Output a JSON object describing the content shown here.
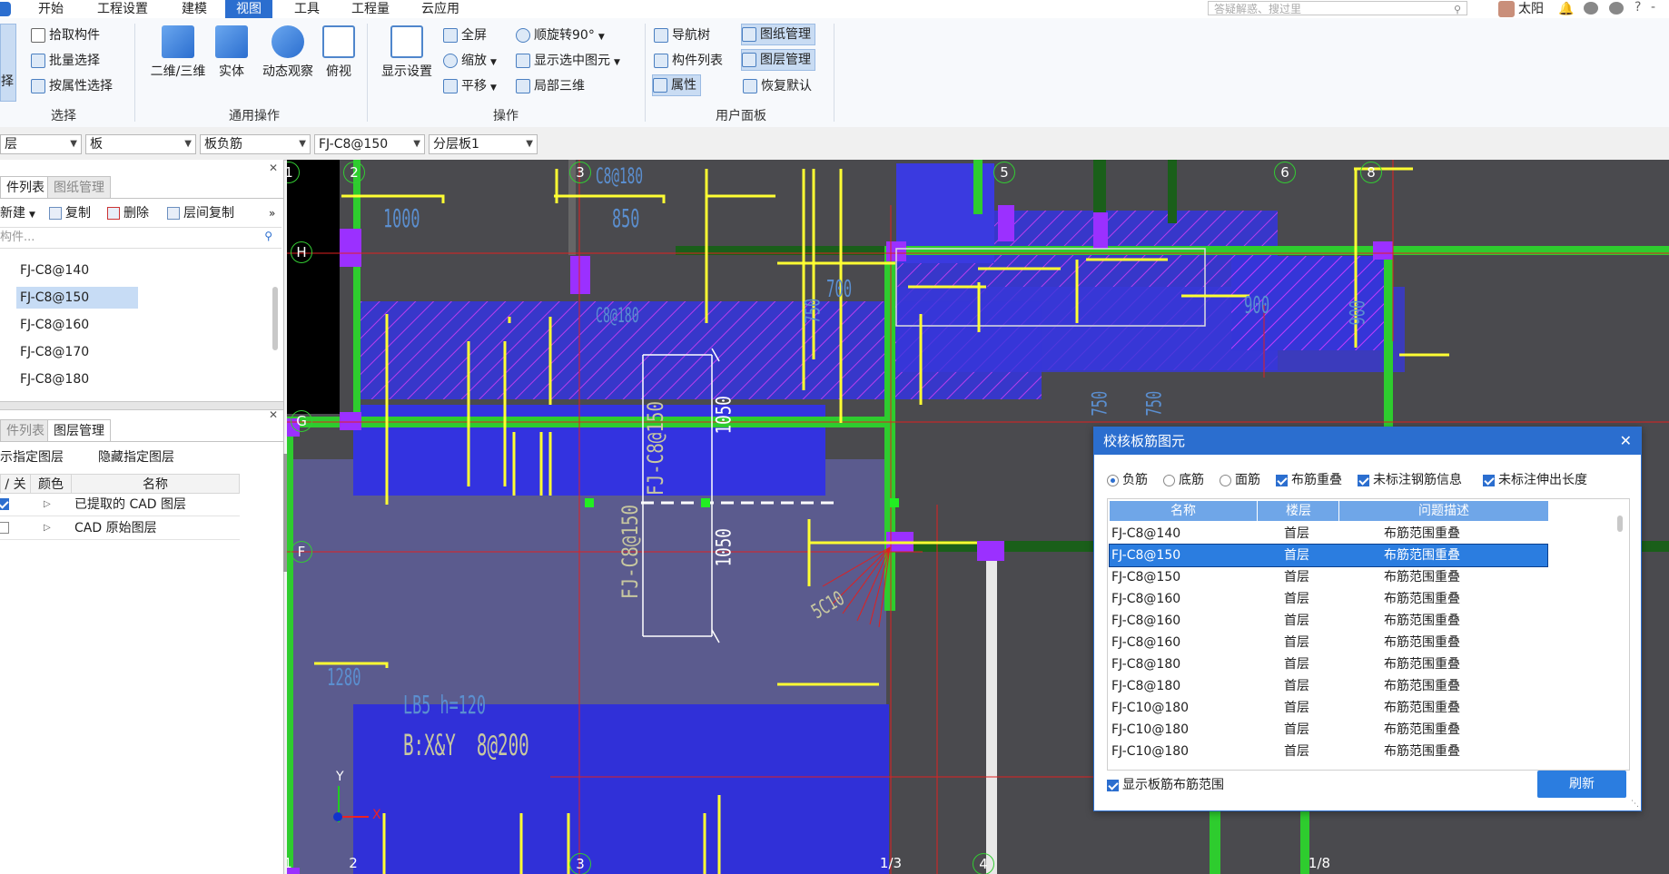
{
  "menu": {
    "items": [
      "开始",
      "工程设置",
      "建模",
      "视图",
      "工具",
      "工程量",
      "云应用"
    ],
    "active_index": 3,
    "search_placeholder": "答疑解惑、搜过里",
    "user_name": "太阳"
  },
  "ribbon": {
    "select_group": {
      "partial_label": "择",
      "pick_component": "拾取构件",
      "batch_select": "批量选择",
      "select_by_attr": "按属性选择",
      "label": "选择"
    },
    "general_ops": {
      "view_2d3d": "二维/三维",
      "solid": "实体",
      "dynamic_observe": "动态观察",
      "top_view": "俯视",
      "label": "通用操作"
    },
    "operations": {
      "display_settings": "显示设置",
      "fullscreen": "全屏",
      "zoom": "缩放",
      "pan": "平移",
      "rotate": "顺旋转90°",
      "show_selected": "显示选中图元",
      "local_3d": "局部三维",
      "label": "操作"
    },
    "user_panel": {
      "nav_tree": "导航树",
      "drawing_mgmt": "图纸管理",
      "component_list": "构件列表",
      "layer_mgmt": "图层管理",
      "properties": "属性",
      "restore_default": "恢复默认",
      "label": "用户面板"
    }
  },
  "filterbar": {
    "combo1": "层",
    "combo2": "板",
    "combo3": "板负筋",
    "combo4": "FJ-C8@150",
    "combo5": "分层板1"
  },
  "left_panel": {
    "tabs": [
      "件列表",
      "图纸管理"
    ],
    "tools": {
      "new": "新建",
      "copy": "复制",
      "delete": "删除",
      "floor_copy": "层间复制"
    },
    "search_placeholder": "构件...",
    "components": [
      "FJ-C8@140",
      "FJ-C8@150",
      "FJ-C8@160",
      "FJ-C8@170",
      "FJ-C8@180"
    ],
    "selected_component_index": 1,
    "lower_tabs": [
      "件列表",
      "图层管理"
    ],
    "layer_actions": {
      "show": "示指定图层",
      "hide": "隐藏指定图层"
    },
    "layer_headers": [
      "/ 关",
      "颜色",
      "名称"
    ],
    "layers": [
      {
        "on": true,
        "name": "已提取的 CAD 图层"
      },
      {
        "on": false,
        "name": "CAD 原始图层"
      }
    ]
  },
  "canvas": {
    "axis_labels_top": [
      "1",
      "2",
      "3",
      "5",
      "6",
      "8"
    ],
    "axis_labels_bottom": [
      "1",
      "2",
      "3",
      "1/3",
      "4",
      "1/8"
    ],
    "axis_labels_left": [
      "H",
      "G",
      "F"
    ],
    "dimension_texts": [
      "1000",
      "850",
      "C8@180",
      "700",
      "750",
      "900",
      "C8@180",
      "1050",
      "1050",
      "FJ-C8@150",
      "FJ-C8@150",
      "5C10",
      "1280",
      "LB5 h=120",
      "B:X&Y  8@200",
      "900",
      "750",
      "750"
    ],
    "axis_indicator": {
      "x": "X",
      "y": "Y"
    }
  },
  "dialog": {
    "title": "校核板筋图元",
    "options": {
      "neg_rebar": "负筋",
      "bottom_rebar": "底筋",
      "top_rebar": "面筋",
      "overlap": "布筋重叠",
      "unmarked_info": "未标注钢筋信息",
      "unmarked_length": "未标注伸出长度"
    },
    "option_state": {
      "radio_selected": "neg_rebar",
      "overlap": true,
      "unmarked_info": true,
      "unmarked_length": true
    },
    "headers": [
      "名称",
      "楼层",
      "问题描述"
    ],
    "rows": [
      [
        "FJ-C8@140",
        "首层",
        "布筋范围重叠"
      ],
      [
        "FJ-C8@150",
        "首层",
        "布筋范围重叠"
      ],
      [
        "FJ-C8@150",
        "首层",
        "布筋范围重叠"
      ],
      [
        "FJ-C8@160",
        "首层",
        "布筋范围重叠"
      ],
      [
        "FJ-C8@160",
        "首层",
        "布筋范围重叠"
      ],
      [
        "FJ-C8@160",
        "首层",
        "布筋范围重叠"
      ],
      [
        "FJ-C8@180",
        "首层",
        "布筋范围重叠"
      ],
      [
        "FJ-C8@180",
        "首层",
        "布筋范围重叠"
      ],
      [
        "FJ-C10@180",
        "首层",
        "布筋范围重叠"
      ],
      [
        "FJ-C10@180",
        "首层",
        "布筋范围重叠"
      ],
      [
        "FJ-C10@180",
        "首层",
        "布筋范围重叠"
      ]
    ],
    "selected_row_index": 1,
    "show_range": "显示板筋布筋范围",
    "refresh": "刷新"
  },
  "colors": {
    "accent": "#2b6ecf",
    "canvas_bg": "#4a4a4e",
    "slab_fill": "#3a3adf",
    "rebar": "#ffff33",
    "wall_green": "#33dd33",
    "column_purple": "#9b30ff"
  }
}
